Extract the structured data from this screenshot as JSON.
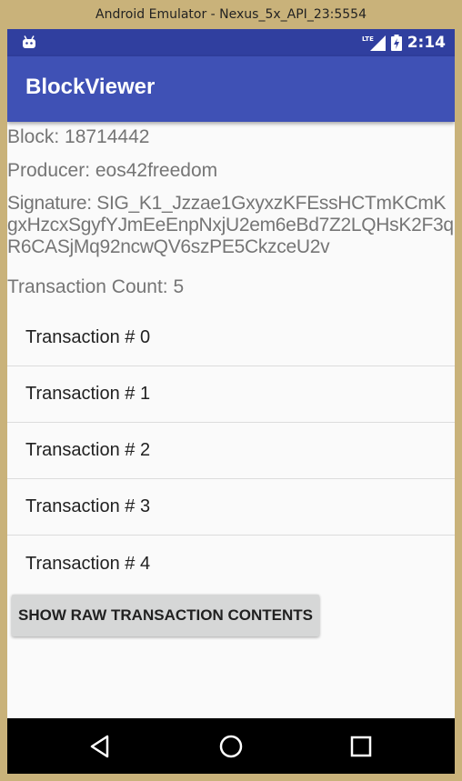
{
  "window": {
    "title": "Android Emulator - Nexus_5x_API_23:5554"
  },
  "status_bar": {
    "time": "2:14",
    "network_label": "LTE"
  },
  "app_bar": {
    "title": "BlockViewer"
  },
  "block": {
    "block_text": "Block:  18714442",
    "producer_text": "Producer:  eos42freedom",
    "signature_text": "Signature:  SIG_K1_Jzzae1GxyxzKFEssHCTmKCmKgxHzcxSgyfYJmEeEnpNxjU2em6eBd7Z2LQHsK2F3qR6CASjMq92ncwQV6szPE5CkzceU2v",
    "transaction_count_text": "Transaction Count: 5"
  },
  "transactions": [
    {
      "label": "Transaction # 0"
    },
    {
      "label": "Transaction # 1"
    },
    {
      "label": "Transaction # 2"
    },
    {
      "label": "Transaction # 3"
    },
    {
      "label": "Transaction # 4"
    }
  ],
  "raw_button": {
    "label": "SHOW RAW TRANSACTION CONTENTS"
  },
  "colors": {
    "status_bar": "#303f9f",
    "app_bar": "#3f51b5",
    "background": "#fafafa",
    "button": "#d6d7d7",
    "info_text": "#757575",
    "frame": "#c9b27a"
  },
  "icons": [
    "android-debug-icon",
    "lte-signal-icon",
    "battery-charging-icon",
    "nav-back-icon",
    "nav-home-icon",
    "nav-recents-icon"
  ]
}
